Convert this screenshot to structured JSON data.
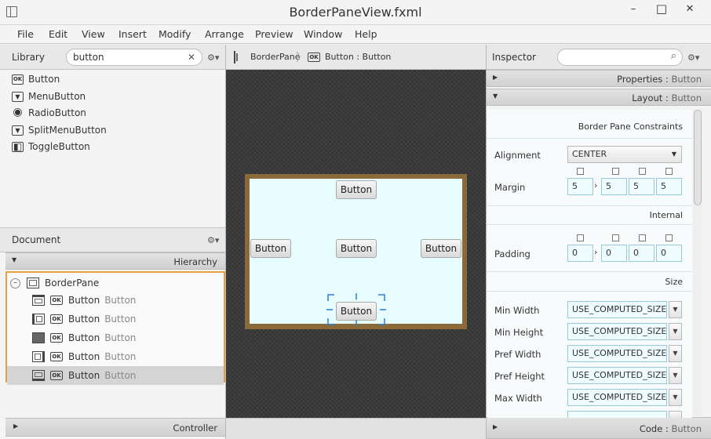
{
  "window": {
    "title": "BorderPaneView.fxml",
    "minimize": "–",
    "maximize": "□",
    "close": "✕"
  },
  "menu": [
    "File",
    "Edit",
    "View",
    "Insert",
    "Modify",
    "Arrange",
    "Preview",
    "Window",
    "Help"
  ],
  "library": {
    "label": "Library",
    "search_value": "button",
    "clear": "✕",
    "gear": "⚙▾",
    "items": [
      {
        "icon": "OK",
        "label": "Button"
      },
      {
        "icon": "▼",
        "label": "MenuButton"
      },
      {
        "icon": "◉",
        "label": "RadioButton"
      },
      {
        "icon": "▼",
        "label": "SplitMenuButton"
      },
      {
        "icon": "◧",
        "label": "ToggleButton"
      }
    ]
  },
  "document": {
    "label": "Document",
    "gear": "⚙▾",
    "hierarchy_label": "Hierarchy",
    "root": "BorderPane",
    "children": [
      {
        "icon": "OK",
        "name": "Button",
        "text": "Button"
      },
      {
        "icon": "OK",
        "name": "Button",
        "text": "Button"
      },
      {
        "icon": "OK",
        "name": "Button",
        "text": "Button"
      },
      {
        "icon": "OK",
        "name": "Button",
        "text": "Button"
      },
      {
        "icon": "OK",
        "name": "Button",
        "text": "Button"
      }
    ],
    "controller_label": "Controller"
  },
  "breadcrumb": {
    "root": "BorderPane",
    "separator": "〉",
    "leaf_icon": "OK",
    "leaf": "Button : Button"
  },
  "canvas": {
    "buttons": {
      "top": "Button",
      "left": "Button",
      "center": "Button",
      "right": "Button",
      "bottom": "Button"
    }
  },
  "inspector": {
    "label": "Inspector",
    "search_icon": "⌕",
    "gear": "⚙▾",
    "properties": {
      "name": "Properties",
      "sep": " : ",
      "obj": "Button"
    },
    "layout": {
      "name": "Layout",
      "sep": " : ",
      "obj": "Button"
    },
    "code": {
      "name": "Code",
      "sep": " : ",
      "obj": "Button"
    },
    "border_pane_constraints": "Border Pane Constraints",
    "alignment_label": "Alignment",
    "alignment_value": "CENTER",
    "margin_label": "Margin",
    "margin_values": [
      "5",
      "5",
      "5",
      "5"
    ],
    "internal_label": "Internal",
    "padding_label": "Padding",
    "padding_values": [
      "0",
      "0",
      "0",
      "0"
    ],
    "size_label": "Size",
    "size_rows": [
      {
        "label": "Min Width",
        "value": "USE_COMPUTED_SIZE"
      },
      {
        "label": "Min Height",
        "value": "USE_COMPUTED_SIZE"
      },
      {
        "label": "Pref Width",
        "value": "USE_COMPUTED_SIZE"
      },
      {
        "label": "Pref Height",
        "value": "USE_COMPUTED_SIZE"
      },
      {
        "label": "Max Width",
        "value": "USE_COMPUTED_SIZE"
      }
    ]
  },
  "colors": {
    "accent": "#e6a23c",
    "canvas_frame": "#8b6a3a",
    "canvas_fill": "#e6fcff",
    "selection": "#2a7fd4"
  }
}
